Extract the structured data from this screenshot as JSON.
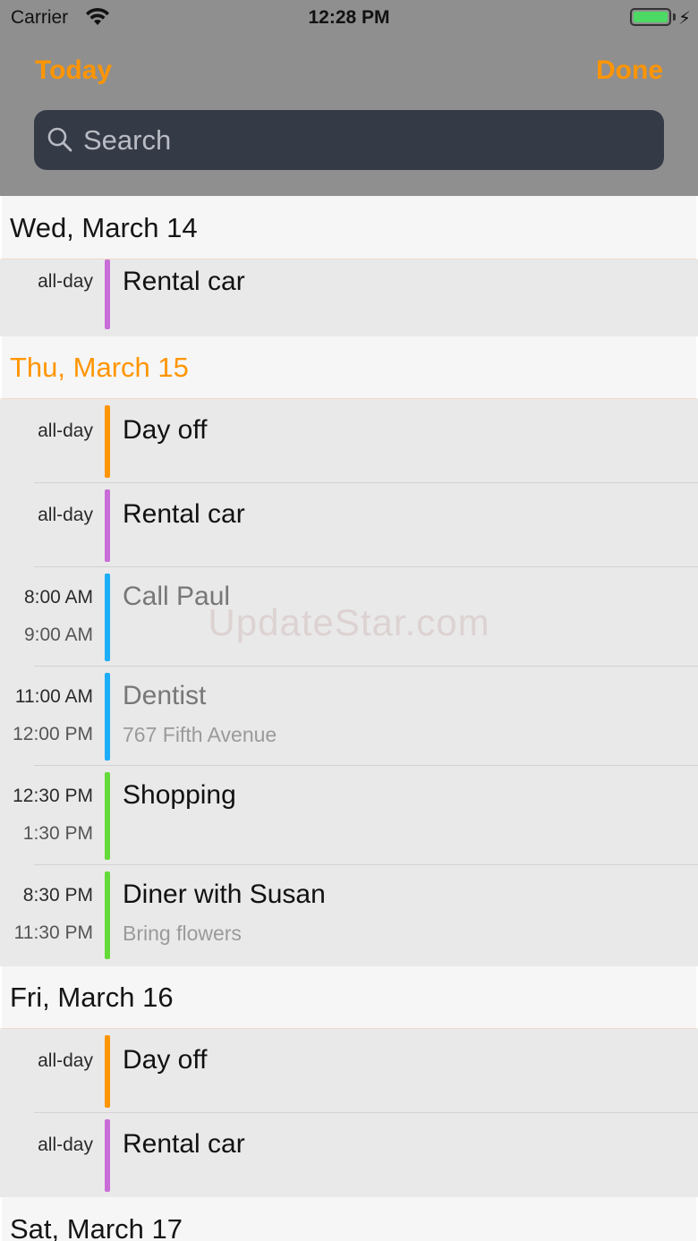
{
  "status_bar": {
    "carrier": "Carrier",
    "time": "12:28 PM"
  },
  "nav": {
    "left_label": "Today",
    "right_label": "Done"
  },
  "search": {
    "placeholder": "Search"
  },
  "sections": [
    {
      "header": "Wed, March 14",
      "events": [
        {
          "time1": "all-day",
          "time2": "",
          "title": "Rental car",
          "subtitle": "",
          "color": "#c86dd7"
        }
      ]
    },
    {
      "header": "Thu, March 15",
      "events": [
        {
          "time1": "all-day",
          "time2": "",
          "title": "Day off",
          "subtitle": "",
          "color": "#ff9500"
        },
        {
          "time1": "all-day",
          "time2": "",
          "title": "Rental car",
          "subtitle": "",
          "color": "#c86dd7"
        },
        {
          "time1": "8:00 AM",
          "time2": "9:00 AM",
          "title": "Call Paul",
          "subtitle": "",
          "color": "#1badf8"
        },
        {
          "time1": "11:00 AM",
          "time2": "12:00 PM",
          "title": "Dentist",
          "subtitle": "767 Fifth Avenue",
          "color": "#1badf8"
        },
        {
          "time1": "12:30 PM",
          "time2": "1:30 PM",
          "title": "Shopping",
          "subtitle": "",
          "color": "#63da38"
        },
        {
          "time1": "8:30 PM",
          "time2": "11:30 PM",
          "title": "Diner with Susan",
          "subtitle": "Bring flowers",
          "color": "#63da38"
        }
      ]
    },
    {
      "header": "Fri, March 16",
      "events": [
        {
          "time1": "all-day",
          "time2": "",
          "title": "Day off",
          "subtitle": "",
          "color": "#ff9500"
        },
        {
          "time1": "all-day",
          "time2": "",
          "title": "Rental car",
          "subtitle": "",
          "color": "#c86dd7"
        }
      ]
    },
    {
      "header": "Sat, March 17",
      "events": []
    }
  ],
  "watermark": "UpdateStar.com",
  "colors": {
    "accent": "#ff9500",
    "search_bg": "#353a47",
    "topbar_bg": "#8f8f8f"
  }
}
